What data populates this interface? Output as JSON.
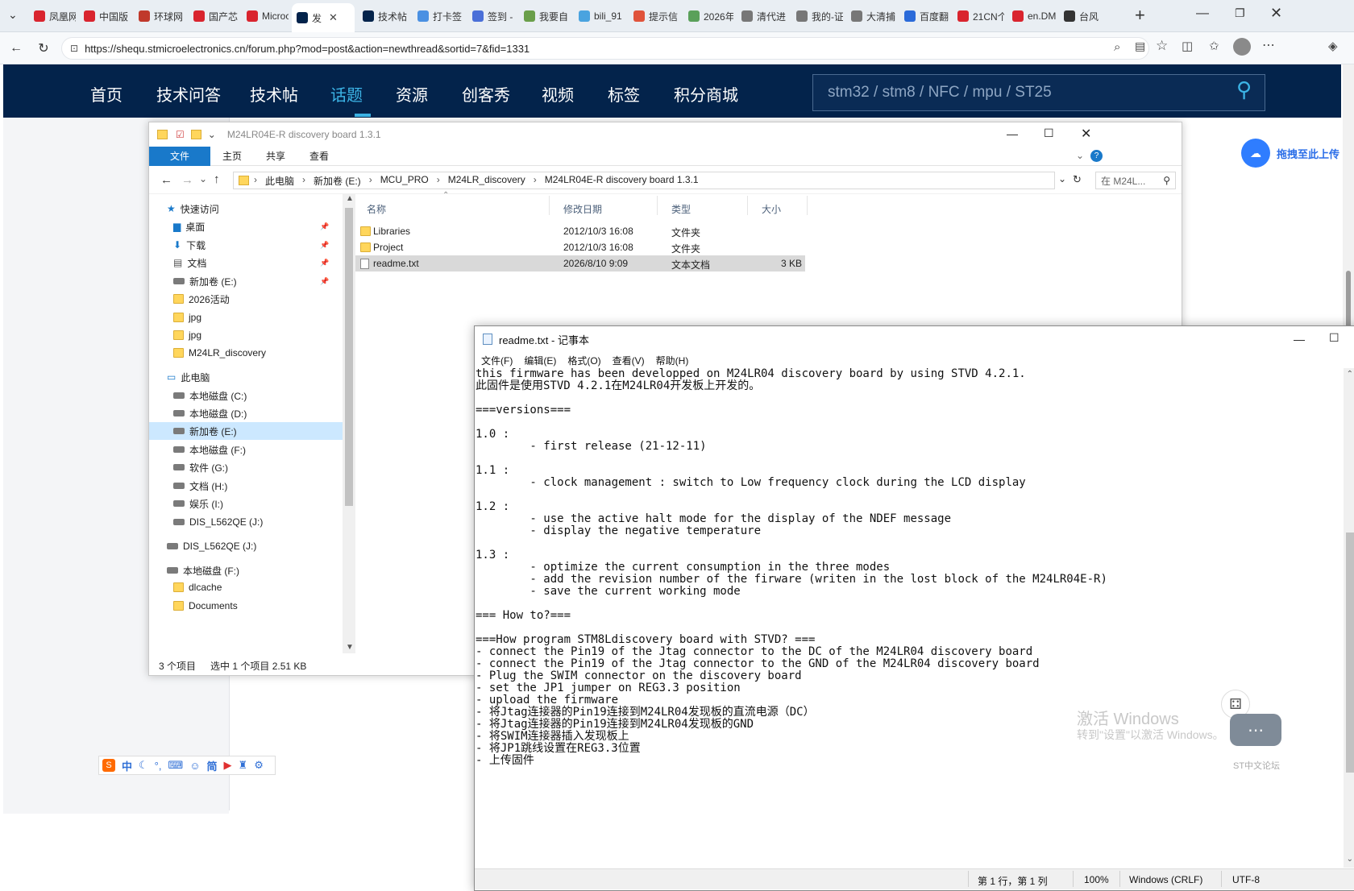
{
  "tabs": [
    {
      "label": "凤凰网",
      "color": "#d9242e"
    },
    {
      "label": "中国版",
      "color": "#d9242e"
    },
    {
      "label": "环球网",
      "color": "#c0392b"
    },
    {
      "label": "国产芯",
      "color": "#d9242e"
    },
    {
      "label": "Microc",
      "color": "#d9242e"
    },
    {
      "label": "发",
      "color": "#03234b"
    },
    {
      "label": "技术帖",
      "color": "#03234b"
    },
    {
      "label": "打卡签",
      "color": "#4a90e2"
    },
    {
      "label": "签到 -",
      "color": "#4a6fd8"
    },
    {
      "label": "我要自",
      "color": "#6a9f4a"
    },
    {
      "label": "bili_91",
      "color": "#4aa3df"
    },
    {
      "label": "提示信",
      "color": "#e0533b"
    },
    {
      "label": "2026年",
      "color": "#5aa05a"
    },
    {
      "label": "清代进",
      "color": "#777777"
    },
    {
      "label": "我的-证",
      "color": "#777777"
    },
    {
      "label": "大清捕",
      "color": "#777777"
    },
    {
      "label": "百度翻",
      "color": "#2a6ad9"
    },
    {
      "label": "21CN个",
      "color": "#d9242e"
    },
    {
      "label": "en.DM",
      "color": "#d9242e"
    },
    {
      "label": "台风",
      "color": "#333333"
    }
  ],
  "address": {
    "url": "https://shequ.stmicroelectronics.cn/forum.php?mod=post&action=newthread&sortid=7&fid=1331"
  },
  "site": {
    "nav": [
      "首页",
      "技术问答",
      "技术帖",
      "话题",
      "资源",
      "创客秀",
      "视频",
      "标签",
      "积分商城"
    ],
    "active_nav": "话题",
    "search_placeholder": "stm32 / stm8 / NFC / mpu / ST25",
    "upload_label": "拖拽至此上传"
  },
  "explorer": {
    "title": "M24LR04E-R discovery board 1.3.1",
    "ribbon_tabs": [
      "文件",
      "主页",
      "共享",
      "查看"
    ],
    "breadcrumb": [
      "此电脑",
      "新加卷 (E:)",
      "MCU_PRO",
      "M24LR_discovery",
      "M24LR04E-R discovery board 1.3.1"
    ],
    "search_placeholder": "在 M24L...",
    "nav": [
      {
        "label": "快速访问",
        "kind": "star"
      },
      {
        "label": "桌面",
        "kind": "desktop"
      },
      {
        "label": "下载",
        "kind": "download"
      },
      {
        "label": "文档",
        "kind": "doc"
      },
      {
        "label": "新加卷 (E:)",
        "kind": "drive"
      },
      {
        "label": "2026活动",
        "kind": "folder"
      },
      {
        "label": "jpg",
        "kind": "folder"
      },
      {
        "label": "jpg",
        "kind": "folder"
      },
      {
        "label": "M24LR_discovery",
        "kind": "folder"
      },
      {
        "label": "此电脑",
        "kind": "pc"
      },
      {
        "label": "本地磁盘 (C:)",
        "kind": "drive"
      },
      {
        "label": "本地磁盘 (D:)",
        "kind": "drive"
      },
      {
        "label": "新加卷 (E:)",
        "kind": "drive"
      },
      {
        "label": "本地磁盘 (F:)",
        "kind": "drive"
      },
      {
        "label": "软件 (G:)",
        "kind": "drive"
      },
      {
        "label": "文档 (H:)",
        "kind": "drive"
      },
      {
        "label": "娱乐 (I:)",
        "kind": "drive"
      },
      {
        "label": "DIS_L562QE (J:)",
        "kind": "drive"
      },
      {
        "label": "DIS_L562QE (J:)",
        "kind": "drive"
      },
      {
        "label": "本地磁盘 (F:)",
        "kind": "drive"
      },
      {
        "label": "dlcache",
        "kind": "folder"
      },
      {
        "label": "Documents",
        "kind": "folder"
      }
    ],
    "columns": [
      "名称",
      "修改日期",
      "类型",
      "大小"
    ],
    "files": [
      {
        "name": "Libraries",
        "date": "2012/10/3 16:08",
        "type": "文件夹",
        "size": ""
      },
      {
        "name": "Project",
        "date": "2012/10/3 16:08",
        "type": "文件夹",
        "size": ""
      },
      {
        "name": "readme.txt",
        "date": "2026/8/10 9:09",
        "type": "文本文档",
        "size": "3 KB"
      }
    ],
    "status": {
      "count": "3 个项目",
      "selected": "选中 1 个项目  2.51 KB"
    }
  },
  "notepad": {
    "title": "readme.txt - 记事本",
    "menu": [
      "文件(F)",
      "编辑(E)",
      "格式(O)",
      "查看(V)",
      "帮助(H)"
    ],
    "lines": [
      "this firmware has been developped on M24LR04 discovery board by using STVD 4.2.1.",
      "此固件是使用STVD 4.2.1在M24LR04开发板上开发的。",
      "",
      "===versions===",
      "",
      "1.0 :",
      "        - first release (21-12-11)",
      "",
      "1.1 :",
      "        - clock management : switch to Low frequency clock during the LCD display",
      "",
      "1.2 :",
      "        - use the active halt mode for the display of the NDEF message",
      "        - display the negative temperature",
      "",
      "1.3 :",
      "        - optimize the current consumption in the three modes",
      "        - add the revision number of the firware (writen in the lost block of the M24LR04E-R)",
      "        - save the current working mode",
      "",
      "=== How to?===",
      "",
      "===How program STM8Ldiscovery board with STVD? ===",
      "- connect the Pin19 of the Jtag connector to the DC of the M24LR04 discovery board",
      "- connect the Pin19 of the Jtag connector to the GND of the M24LR04 discovery board",
      "- Plug the SWIM connector on the discovery board",
      "- set the JP1 jumper on REG3.3 position",
      "- upload the firmware",
      "- 将Jtag连接器的Pin19连接到M24LR04发现板的直流电源（DC）",
      "- 将Jtag连接器的Pin19连接到M24LR04发现板的GND",
      "- 将SWIM连接器插入发现板上",
      "- 将JP1跳线设置在REG3.3位置",
      "- 上传固件"
    ],
    "status": {
      "position": "第 1 行，第 1 列",
      "zoom": "100%",
      "eol": "Windows (CRLF)",
      "encoding": "UTF-8"
    }
  },
  "overlay": {
    "activate_title": "激活 Windows",
    "activate_sub": "转到\"设置\"以激活 Windows。",
    "st_chat": "ST中文论坛",
    "ime": [
      "中",
      "简"
    ]
  }
}
